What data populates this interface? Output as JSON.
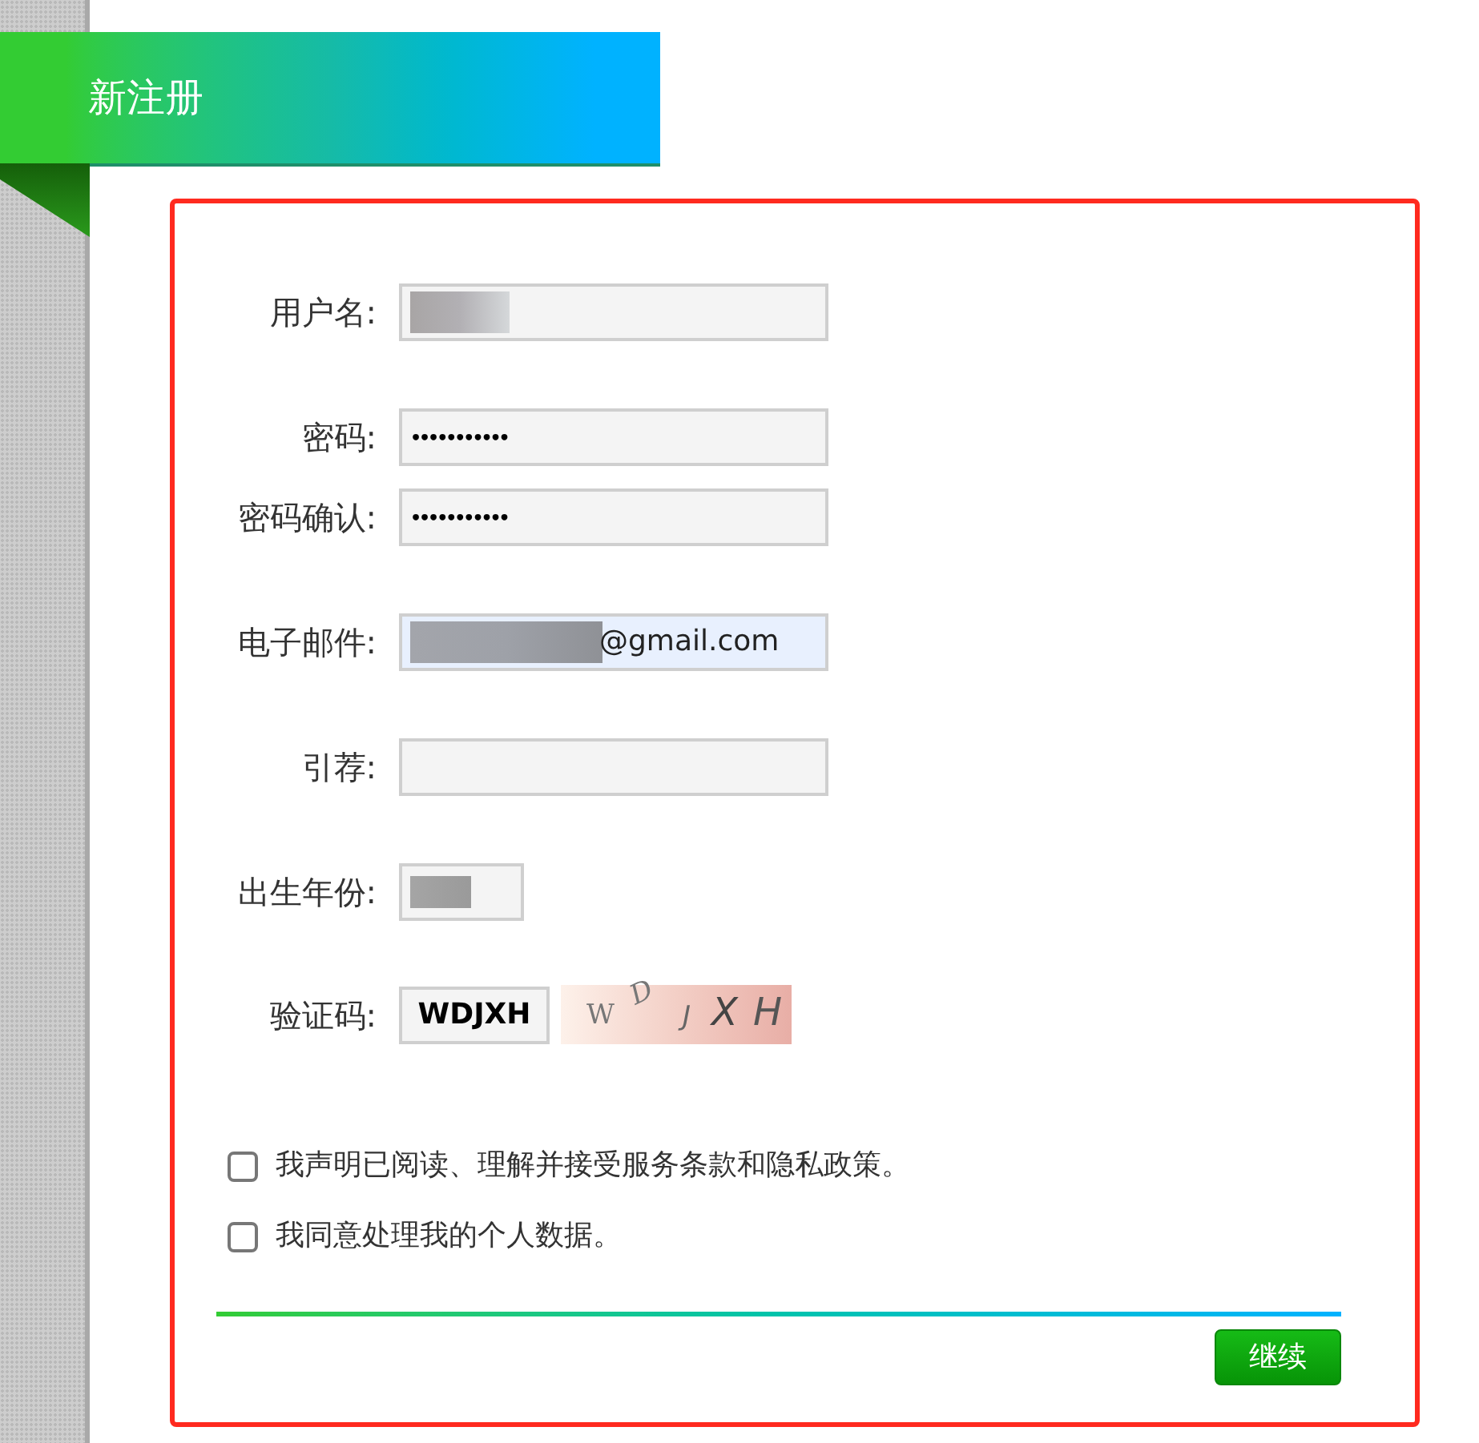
{
  "header": {
    "title": "新注册"
  },
  "field_groups": [
    [
      {
        "label": "用户名:",
        "kind": "text",
        "redacted": true,
        "autofilled": false
      }
    ],
    [
      {
        "label": "密码:",
        "kind": "password",
        "value": "•••••••••••",
        "redacted": false,
        "autofilled": false
      },
      {
        "label": "密码确认:",
        "kind": "password",
        "value": "•••••••••••",
        "redacted": false,
        "autofilled": false
      }
    ],
    [
      {
        "label": "电子邮件:",
        "kind": "email",
        "value": "@gmail.com",
        "redacted": true,
        "autofilled": true
      }
    ],
    [
      {
        "label": "引荐:",
        "kind": "text",
        "redacted": false,
        "autofilled": false
      }
    ],
    [
      {
        "label": "出生年份:",
        "kind": "year",
        "redacted": true,
        "autofilled": false
      }
    ]
  ],
  "captcha": {
    "label": "验证码:",
    "value": "WDJXH",
    "image_letters": [
      "W",
      "D",
      "J",
      "X",
      "H"
    ]
  },
  "checkboxes": [
    {
      "label": "我声明已阅读、理解并接受服务条款和隐私政策。",
      "checked": false
    },
    {
      "label": "我同意处理我的个人数据。",
      "checked": false
    }
  ],
  "submit_button": {
    "label": "继续"
  }
}
